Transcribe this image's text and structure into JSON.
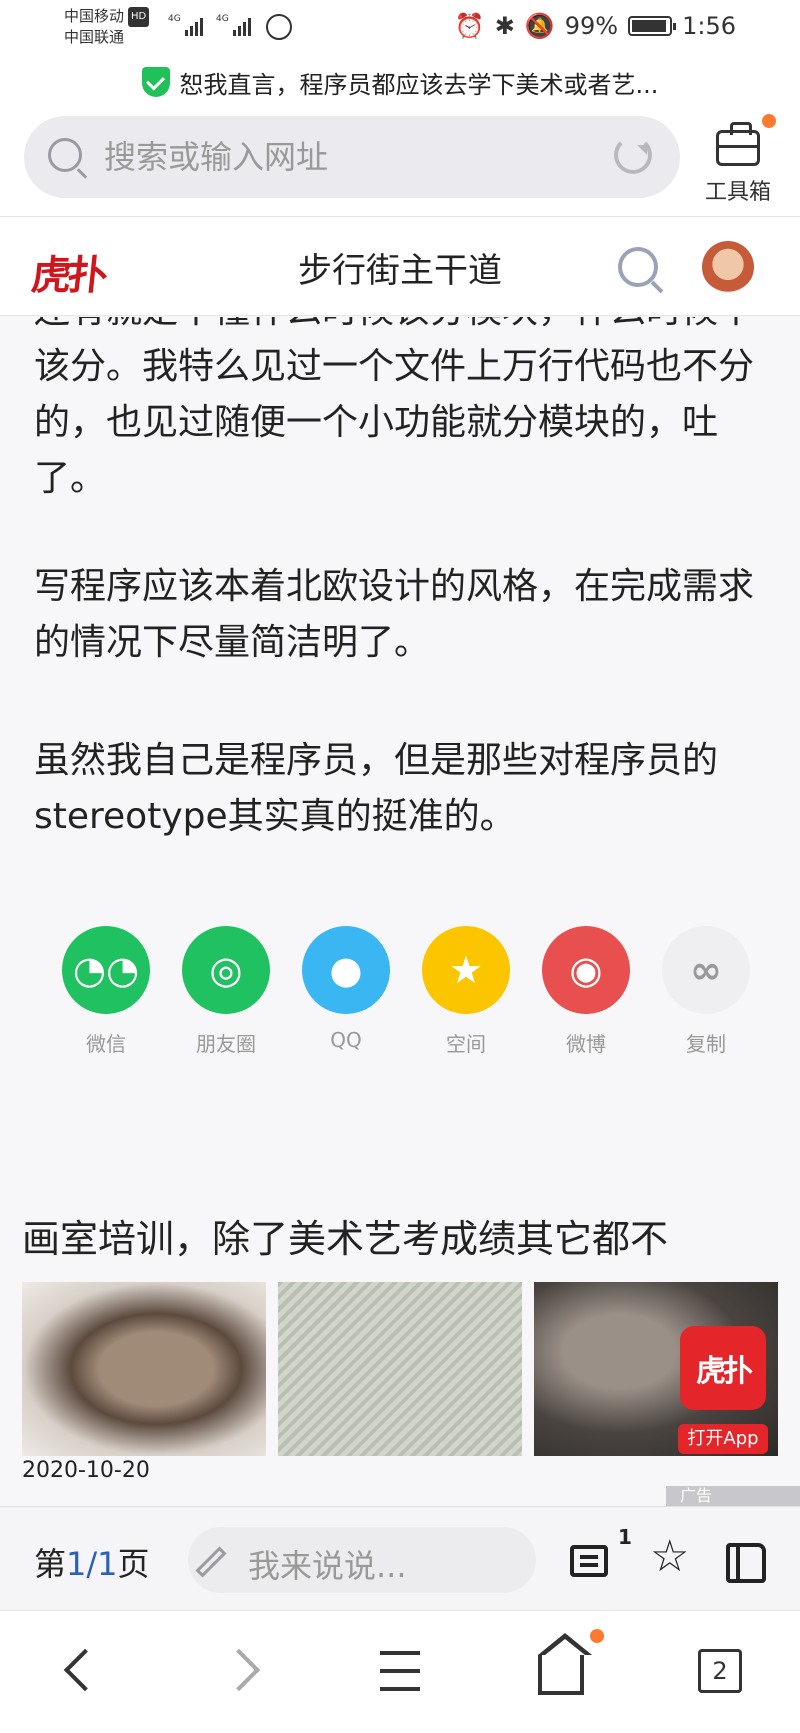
{
  "status_bar": {
    "carrier_1": "中国移动",
    "carrier_2": "中国联通",
    "hd_badge": "HD",
    "network_1": "4G",
    "network_2": "4G",
    "battery_percent": "99%",
    "time": "1:56"
  },
  "page_title": "恕我直言，程序员都应该去学下美术或者艺...",
  "search": {
    "placeholder": "搜索或输入网址"
  },
  "toolbox": {
    "label": "工具箱"
  },
  "site": {
    "logo_text": "虎扑",
    "title": "步行街主干道"
  },
  "article": {
    "paragraphs": [
      "还有就是不懂什么时候该分模块，什么时候不该分。我特么见过一个文件上万行代码也不分的，也见过随便一个小功能就分模块的，吐了。",
      "写程序应该本着北欧设计的风格，在完成需求的情况下尽量简洁明了。",
      "虽然我自己是程序员，但是那些对程序员的stereotype其实真的挺准的。"
    ]
  },
  "share": {
    "items": [
      {
        "label": "微信",
        "icon": "wechat-icon",
        "color": "#1fc160"
      },
      {
        "label": "朋友圈",
        "icon": "moments-icon",
        "color": "#1fc160"
      },
      {
        "label": "QQ",
        "icon": "qq-icon",
        "color": "#3ab6f2"
      },
      {
        "label": "空间",
        "icon": "qzone-icon",
        "color": "#fbc500"
      },
      {
        "label": "微博",
        "icon": "weibo-icon",
        "color": "#e8504f"
      },
      {
        "label": "复制",
        "icon": "link-icon",
        "color": "#efeff2"
      }
    ]
  },
  "ad": {
    "title": "画室培训，除了美术艺考成绩其它都不",
    "date": "2020-10-20",
    "open_app": "打开App",
    "app_logo": "虎扑",
    "badge": "广告"
  },
  "comment_bar": {
    "page_prefix": "第",
    "page_current": "1",
    "page_sep": "/",
    "page_total": "1",
    "page_suffix": "页",
    "placeholder": "我来说说...",
    "comment_count": "1"
  },
  "nav": {
    "tab_count": "2"
  },
  "colors": {
    "accent_orange": "#ff7a2e",
    "brand_red": "#e4252a",
    "page_link_blue": "#2b5fb8"
  }
}
